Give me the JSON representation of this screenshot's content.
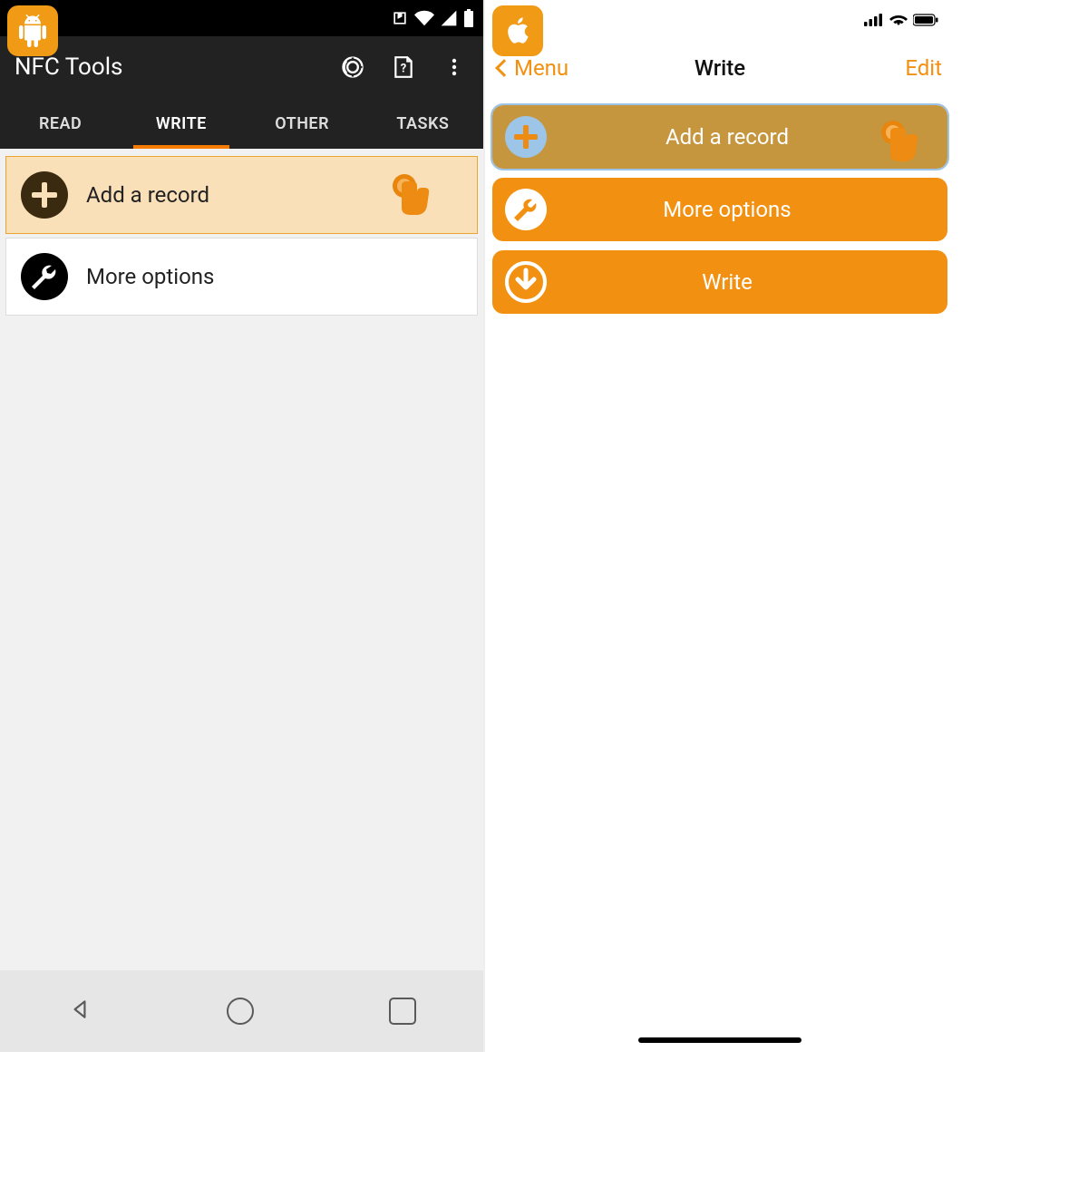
{
  "colors": {
    "android_accent": "#f57c00",
    "ios_accent": "#f29111",
    "highlight_bg_android": "#f9e0b8",
    "highlight_bg_ios": "#c5963e"
  },
  "android": {
    "app_title": "NFC Tools",
    "tabs": [
      "READ",
      "WRITE",
      "OTHER",
      "TASKS"
    ],
    "active_tab_index": 1,
    "items": [
      {
        "label": "Add a record",
        "icon": "plus-circle-icon",
        "highlighted": true
      },
      {
        "label": "More options",
        "icon": "wrench-circle-icon",
        "highlighted": false
      }
    ]
  },
  "ios": {
    "nav_back_label": "Menu",
    "nav_title": "Write",
    "nav_edit_label": "Edit",
    "buttons": [
      {
        "label": "Add a record",
        "icon": "plus-circle-icon",
        "highlighted": true
      },
      {
        "label": "More options",
        "icon": "wrench-circle-icon",
        "highlighted": false
      },
      {
        "label": "Write",
        "icon": "download-circle-icon",
        "highlighted": false
      }
    ]
  }
}
